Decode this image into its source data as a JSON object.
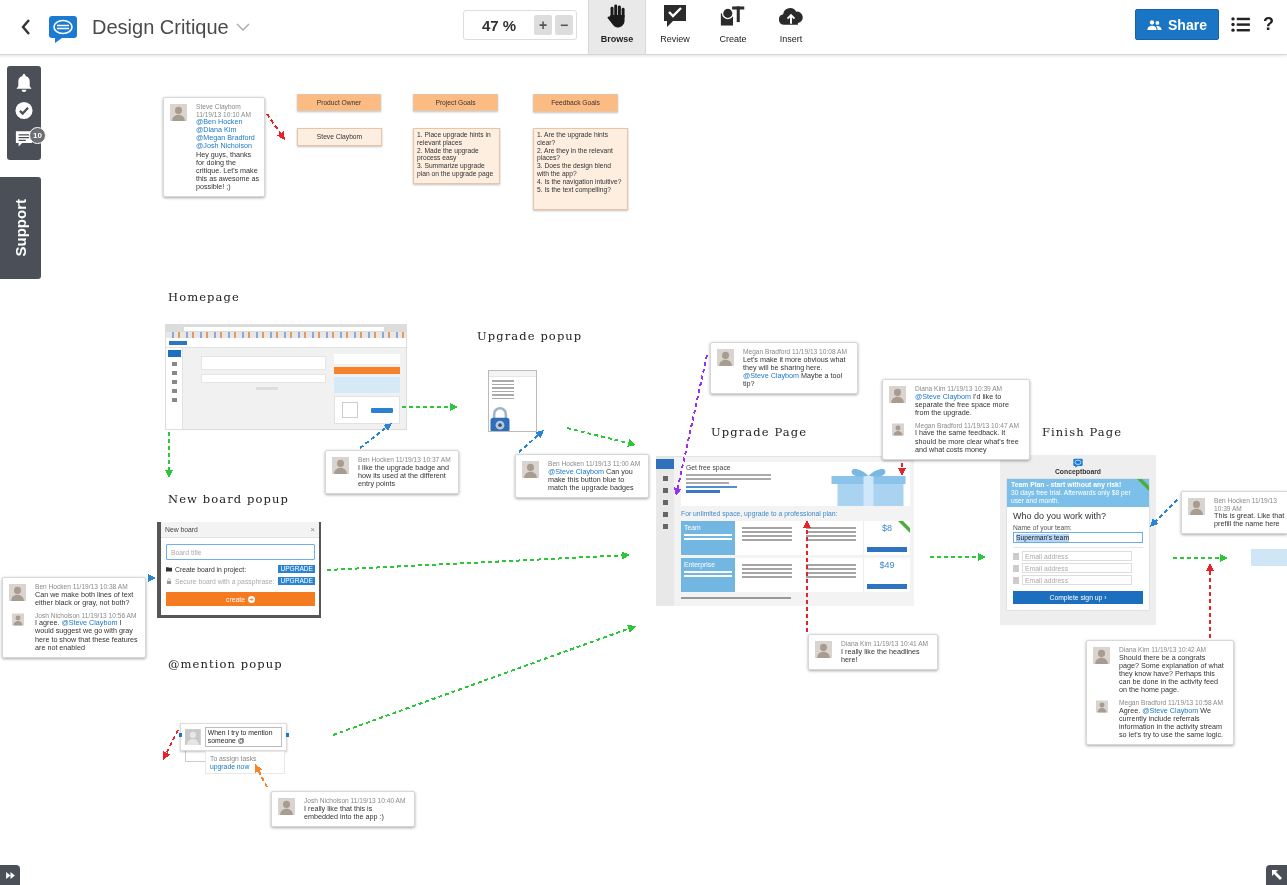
{
  "toolbar": {
    "title": "Design Critique",
    "zoom": "47 %",
    "zoom_in": "+",
    "zoom_out": "−",
    "modes": [
      {
        "label": "Browse",
        "selected": true
      },
      {
        "label": "Review",
        "selected": false
      },
      {
        "label": "Create",
        "selected": false
      },
      {
        "label": "Insert",
        "selected": false
      }
    ],
    "share": "Share",
    "help": "?"
  },
  "side_panel": {
    "comment_count": "10",
    "support": "Support"
  },
  "board": {
    "headings": [
      "Homepage",
      "Upgrade popup",
      "Upgrade Page",
      "Finish Page",
      "New board popup",
      "@mention popup"
    ],
    "sticky_notes": [
      {
        "kind": "title",
        "text": "Product Owner"
      },
      {
        "kind": "title",
        "text": "Project Goals"
      },
      {
        "kind": "title",
        "text": "Feedback Goals"
      },
      {
        "kind": "label",
        "text": "Steve Claybom"
      },
      {
        "kind": "list",
        "items": [
          "1. Place upgrade hints in relevant places",
          "2. Made the upgrade process easy",
          "3. Summarize upgrade plan on the upgrade page"
        ]
      },
      {
        "kind": "list",
        "items": [
          "1. Are the upgrade hints clear?",
          "2. Are they in the relevant places?",
          "3. Does the design blend with the app?",
          "4. Is the navigation intuitive?",
          "5. Is the text compelling?"
        ]
      }
    ],
    "comment_threads": [
      {
        "comments": [
          {
            "author": "Steve Claybom 11/19/13 10:10 AM",
            "parts": [
              {
                "kind": "mention",
                "text": "@Ben Hocken"
              },
              {
                "kind": "mention",
                "text": "@Diana Kim"
              },
              {
                "kind": "mention",
                "text": "@Megan Bradford"
              },
              {
                "kind": "mention",
                "text": "@Josh Nicholson"
              },
              {
                "kind": "text",
                "text": "Hey guys, thanks for doing the critique. Let's make this as awesome as possible! ;)"
              }
            ]
          }
        ]
      },
      {
        "comments": [
          {
            "author": "Megan Bradford 11/19/13 10:08 AM",
            "parts": [
              {
                "kind": "text",
                "text": "Let's make it more obvious what they will be sharing here."
              },
              {
                "kind": "mention",
                "text": "@Steve Claybom"
              },
              {
                "kind": "text",
                "text": "Maybe a tool tip?"
              }
            ]
          }
        ]
      },
      {
        "comments": [
          {
            "author": "Diana Kim 11/19/13 10:39 AM",
            "parts": [
              {
                "kind": "mention",
                "text": "@Steve Claybom"
              },
              {
                "kind": "text",
                "text": "I'd like to separate the free space more from the upgrade."
              }
            ]
          },
          {
            "author": "Megan Bradford 11/19/13 10:47 AM",
            "parts": [
              {
                "kind": "text",
                "text": "I have the same feedback. It should be more clear what's free and what costs money"
              }
            ]
          }
        ]
      },
      {
        "comments": [
          {
            "author": "Ben Hocken 11/19/13 10:37 AM",
            "parts": [
              {
                "kind": "text",
                "text": "I like the upgrade badge and how its used at the different entry points"
              }
            ]
          }
        ]
      },
      {
        "comments": [
          {
            "author": "Ben Hocken 11/19/13 11:00 AM",
            "parts": [
              {
                "kind": "mention",
                "text": "@Steve Claybom"
              },
              {
                "kind": "text",
                "text": "Can you make this button blue to match the upgrade badges"
              }
            ]
          }
        ]
      },
      {
        "comments": [
          {
            "author": "Ben Hocken 11/19/13 10:39 AM",
            "parts": [
              {
                "kind": "line",
                "text": "This is great. Like that"
              },
              {
                "kind": "line",
                "text": "prefill the name here"
              }
            ]
          }
        ]
      },
      {
        "comments": [
          {
            "author": "Ben Hocken 11/19/13 10:38 AM",
            "parts": [
              {
                "kind": "text",
                "text": "Can we make both lines of text either black or gray, not both?"
              }
            ]
          },
          {
            "author": "Josh Nicholson 11/19/13 10:56 AM",
            "parts": [
              {
                "kind": "text",
                "text": "I agree."
              },
              {
                "kind": "mention",
                "text": "@Steve Claybom"
              },
              {
                "kind": "text",
                "text": "I would suggest we go with gray here to show that these features are not enabled"
              }
            ]
          }
        ]
      },
      {
        "comments": [
          {
            "author": "Diana Kim 11/19/13 10:41 AM",
            "parts": [
              {
                "kind": "text",
                "text": "I really like the headlines here!"
              }
            ]
          }
        ]
      },
      {
        "comments": [
          {
            "author": "Diana Kim 11/19/13 10:42 AM",
            "parts": [
              {
                "kind": "text",
                "text": "Should there be a congrats page? Some explanation of what they know have? Perhaps this can be done in the activity feed on the home page."
              }
            ]
          },
          {
            "author": "Megan Bradford 11/19/13 10:58 AM",
            "parts": [
              {
                "kind": "text",
                "text": "Agree."
              },
              {
                "kind": "mention",
                "text": "@Steve Claybom"
              },
              {
                "kind": "text",
                "text": "We currently include referrals information in the activity stream so let's try to use the same logic."
              }
            ]
          }
        ]
      },
      {
        "comments": [
          {
            "author": "Josh Nicholson 11/19/13 10:40 AM",
            "parts": [
              {
                "kind": "text",
                "text": "I really like that this is embedded into the app :)"
              }
            ]
          }
        ]
      }
    ],
    "connectors": [
      {
        "color": "#e3242b"
      },
      {
        "color": "#2cc63a"
      },
      {
        "color": "#2cc63a"
      },
      {
        "color": "#2a84d2"
      },
      {
        "color": "#2cc63a"
      },
      {
        "color": "#2a84d2"
      },
      {
        "color": "#9b2ff0"
      },
      {
        "color": "#e3242b"
      },
      {
        "color": "#2a84d2"
      },
      {
        "color": "#2cc63a"
      },
      {
        "color": "#e3242b"
      },
      {
        "color": "#2cc63a"
      },
      {
        "color": "#2a84d2"
      },
      {
        "color": "#2cc63a"
      },
      {
        "color": "#e3242b"
      },
      {
        "color": "#2cc63a"
      },
      {
        "color": "#e3242b"
      },
      {
        "color": "#f5862a"
      }
    ],
    "upgrade_page": {
      "section_title": "Get free space",
      "headline": "For unlimited space, upgrade to a professional plan:",
      "plans": [
        {
          "name": "Team",
          "price": "$8"
        },
        {
          "name": "Enterprise",
          "price": "$49"
        }
      ]
    },
    "finish_page": {
      "brand": "Conceptboard",
      "banner": "Team Plan - start without any risk!",
      "banner_note": "30 days free trial. Afterwards only $8 per user and month.",
      "question": "Who do you work with?",
      "team_label": "Name of your team:",
      "team_value": "Superman's team",
      "team_value_highlighted": true,
      "email_placeholders": [
        "Email address",
        "Email address",
        "Email address"
      ],
      "button": "Complete sign up ›"
    },
    "new_board_popup": {
      "title": "New board",
      "close": "×",
      "title_placeholder": "Board title",
      "options": [
        {
          "kind": "folder",
          "label": "Create board in project:",
          "badge": "UPGRADE",
          "disabled": false
        },
        {
          "kind": "lock",
          "label": "Secure board with a passphrase:",
          "badge": "UPGRADE",
          "disabled": true
        }
      ],
      "button": "create"
    },
    "mention_popup": {
      "input_value": "When I try to mention someone @",
      "hint": "To assign tasks",
      "hint_link": "upgrade now"
    }
  }
}
